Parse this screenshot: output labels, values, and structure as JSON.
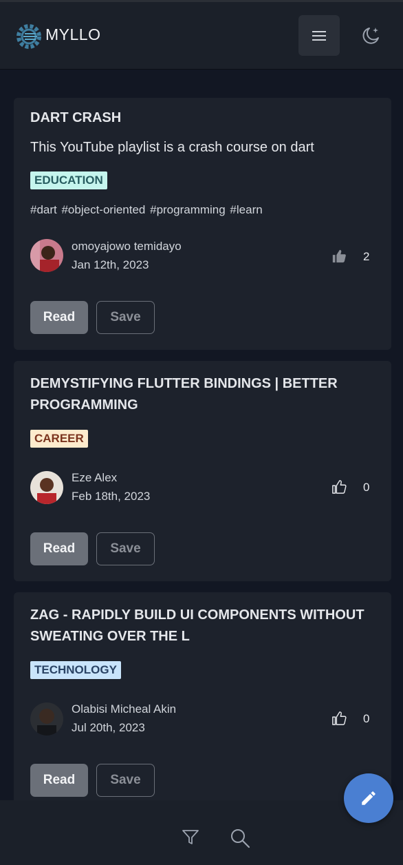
{
  "header": {
    "brand": "MYLLO",
    "logo_icon": "cog-circuit-icon",
    "menu_icon": "hamburger-icon",
    "theme_icon": "moon-stars-icon"
  },
  "posts": [
    {
      "title": "DART CRASH",
      "description": "This YouTube playlist is a crash course on dart",
      "category": "EDUCATION",
      "category_bg": "#c5f5ed",
      "category_fg": "#285e61",
      "tags": "#dart #object-oriented #programming #learn",
      "author": "omoyajowo temidayo",
      "date": "Jan 12th, 2023",
      "likes": "2",
      "liked": true,
      "read_label": "Read",
      "save_label": "Save"
    },
    {
      "title": "DEMYSTIFYING FLUTTER BINDINGS | BETTER PROGRAMMING",
      "category": "CAREER",
      "category_bg": "#fdebcd",
      "category_fg": "#7b341e",
      "author": "Eze Alex",
      "date": "Feb 18th, 2023",
      "likes": "0",
      "liked": false,
      "read_label": "Read",
      "save_label": "Save"
    },
    {
      "title": "ZAG - RAPIDLY BUILD UI COMPONENTS WITHOUT SWEATING OVER THE L",
      "category": "TECHNOLOGY",
      "category_bg": "#c9e4fb",
      "category_fg": "#2a4365",
      "author": "Olabisi Micheal Akin",
      "date": "Jul 20th, 2023",
      "likes": "0",
      "liked": false,
      "read_label": "Read",
      "save_label": "Save"
    }
  ],
  "bottom_nav": {
    "filter_icon": "filter-icon",
    "search_icon": "search-icon"
  },
  "fab": {
    "icon": "pencil-icon",
    "color": "#4a7fd2"
  }
}
